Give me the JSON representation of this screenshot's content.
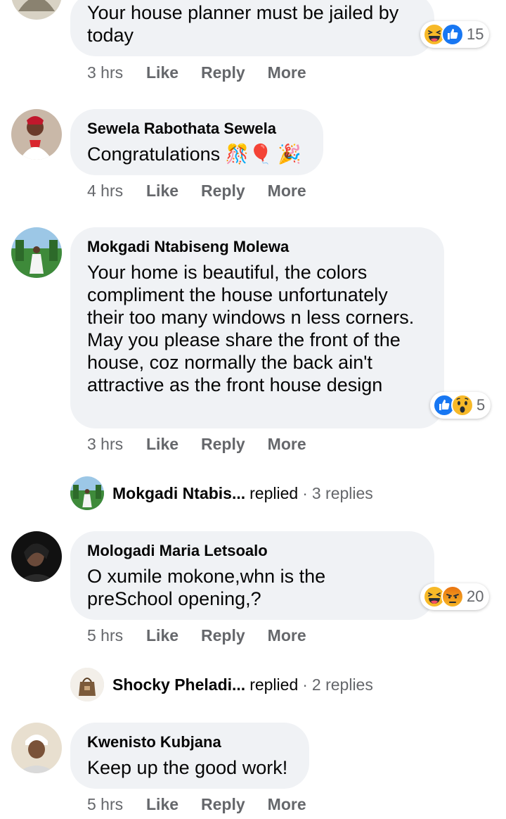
{
  "comments": [
    {
      "author": "",
      "text": "Your house planner must be jailed by today",
      "time": "3 hrs",
      "reactions": {
        "icons": [
          "haha-icon",
          "like-icon"
        ],
        "count": "15"
      }
    },
    {
      "author": "Sewela Rabothata Sewela",
      "text": "Congratulations 🎊🎈 🎉",
      "time": "4 hrs"
    },
    {
      "author": "Mokgadi Ntabiseng Molewa",
      "text": "Your home is beautiful, the colors compliment the house unfortunately their too many windows n less corners. May you please share the front of the house, coz normally the back ain't attractive as the front house design",
      "time": "3 hrs",
      "reactions": {
        "icons": [
          "like-icon",
          "wow-icon"
        ],
        "count": "5"
      },
      "replies": {
        "name": "Mokgadi Ntabis...",
        "verb": "replied",
        "dot": "·",
        "count": "3 replies"
      }
    },
    {
      "author": "Mologadi Maria Letsoalo",
      "text": "O xumile mokone,whn is the preSchool opening,?",
      "time": "5 hrs",
      "reactions": {
        "icons": [
          "haha-icon",
          "angry-icon"
        ],
        "count": "20"
      },
      "replies": {
        "name": "Shocky Pheladi...",
        "verb": "replied",
        "dot": "·",
        "count": "2 replies"
      }
    },
    {
      "author": "Kwenisto Kubjana",
      "text": "Keep up the good work!",
      "time": "5 hrs"
    }
  ],
  "actions": {
    "like": "Like",
    "reply": "Reply",
    "more": "More"
  },
  "colors": {
    "bubble": "#f0f2f5",
    "meta": "#65676b",
    "like_blue": "#1877f2",
    "emoji_yellow": "#f7b928",
    "angry_orange": "#e9710f"
  }
}
